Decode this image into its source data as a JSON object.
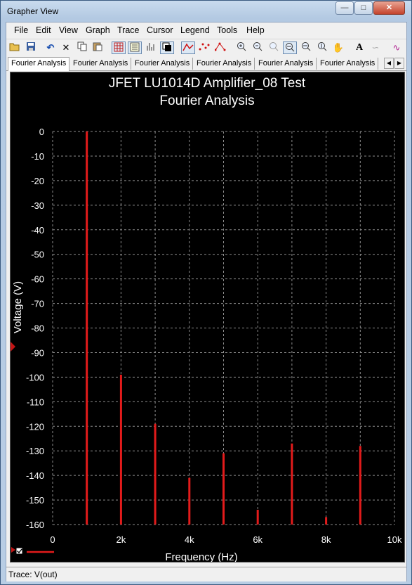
{
  "window": {
    "title": "Grapher View"
  },
  "menu": [
    "File",
    "Edit",
    "View",
    "Graph",
    "Trace",
    "Cursor",
    "Legend",
    "Tools",
    "Help"
  ],
  "tabs": [
    "Fourier Analysis",
    "Fourier Analysis",
    "Fourier Analysis",
    "Fourier Analysis",
    "Fourier Analysis",
    "Fourier Analysis"
  ],
  "status": {
    "text": "Trace: V(out)"
  },
  "colors": {
    "background": "#000000",
    "grid": "#8c8c8c",
    "trace": "#e31b1b",
    "text": "#ffffff"
  },
  "chart_data": {
    "type": "bar",
    "title": "JFET LU1014D Amplifier_08 Test",
    "subtitle": "Fourier Analysis",
    "xlabel": "Frequency (Hz)",
    "ylabel": "Voltage (V)",
    "xlim": [
      0,
      10000
    ],
    "ylim": [
      -160,
      0
    ],
    "x_tick_labels": [
      "0",
      "2k",
      "4k",
      "6k",
      "8k",
      "10k"
    ],
    "y_tick_labels": [
      "0",
      "-10",
      "-20",
      "-30",
      "-40",
      "-50",
      "-60",
      "-70",
      "-80",
      "-90",
      "-100",
      "-110",
      "-120",
      "-130",
      "-140",
      "-150",
      "-160"
    ],
    "grid": true,
    "series": [
      {
        "name": "V(out)",
        "x": [
          1000,
          2000,
          3000,
          4000,
          5000,
          6000,
          7000,
          8000,
          9000
        ],
        "values": [
          2,
          -99,
          -119,
          -141,
          -131,
          -154,
          -127,
          -157,
          -128
        ]
      }
    ],
    "legend": {
      "position": "bottom-left"
    }
  }
}
